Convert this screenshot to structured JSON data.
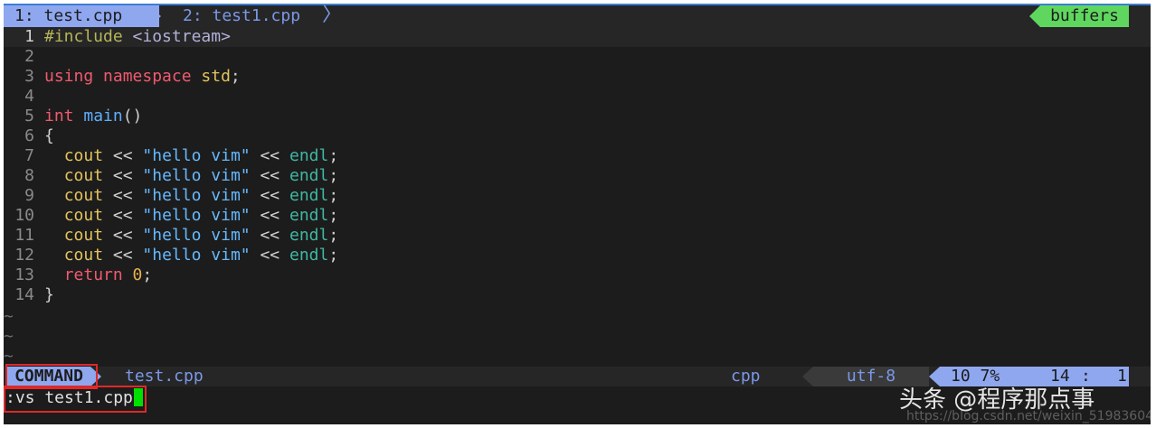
{
  "tabline": {
    "tabs": [
      {
        "label": "1: test.cpp",
        "active": true
      },
      {
        "label": "2: test1.cpp",
        "active": false
      }
    ],
    "separator": "〉",
    "buffers_label": "buffers"
  },
  "editor": {
    "lines": [
      {
        "num": "1",
        "tokens": [
          [
            "c-pre",
            "#include "
          ],
          [
            "c-inc",
            "<iostream>"
          ]
        ]
      },
      {
        "num": "2",
        "tokens": []
      },
      {
        "num": "3",
        "tokens": [
          [
            "c-kw",
            "using namespace "
          ],
          [
            "c-id",
            "std"
          ],
          [
            "c-pl",
            ";"
          ]
        ]
      },
      {
        "num": "4",
        "tokens": []
      },
      {
        "num": "5",
        "tokens": [
          [
            "c-kw",
            "int "
          ],
          [
            "c-fn",
            "main"
          ],
          [
            "c-pl",
            "()"
          ]
        ]
      },
      {
        "num": "6",
        "tokens": [
          [
            "c-pl",
            "{"
          ]
        ]
      },
      {
        "num": "7",
        "tokens": [
          [
            "c-pl",
            "  "
          ],
          [
            "c-id",
            "cout"
          ],
          [
            "c-pl",
            " << "
          ],
          [
            "c-str",
            "\"hello vim\""
          ],
          [
            "c-pl",
            " << "
          ],
          [
            "c-cy",
            "endl"
          ],
          [
            "c-pl",
            ";"
          ]
        ]
      },
      {
        "num": "8",
        "tokens": [
          [
            "c-pl",
            "  "
          ],
          [
            "c-id",
            "cout"
          ],
          [
            "c-pl",
            " << "
          ],
          [
            "c-str",
            "\"hello vim\""
          ],
          [
            "c-pl",
            " << "
          ],
          [
            "c-cy",
            "endl"
          ],
          [
            "c-pl",
            ";"
          ]
        ]
      },
      {
        "num": "9",
        "tokens": [
          [
            "c-pl",
            "  "
          ],
          [
            "c-id",
            "cout"
          ],
          [
            "c-pl",
            " << "
          ],
          [
            "c-str",
            "\"hello vim\""
          ],
          [
            "c-pl",
            " << "
          ],
          [
            "c-cy",
            "endl"
          ],
          [
            "c-pl",
            ";"
          ]
        ]
      },
      {
        "num": "10",
        "tokens": [
          [
            "c-pl",
            "  "
          ],
          [
            "c-id",
            "cout"
          ],
          [
            "c-pl",
            " << "
          ],
          [
            "c-str",
            "\"hello vim\""
          ],
          [
            "c-pl",
            " << "
          ],
          [
            "c-cy",
            "endl"
          ],
          [
            "c-pl",
            ";"
          ]
        ]
      },
      {
        "num": "11",
        "tokens": [
          [
            "c-pl",
            "  "
          ],
          [
            "c-id",
            "cout"
          ],
          [
            "c-pl",
            " << "
          ],
          [
            "c-str",
            "\"hello vim\""
          ],
          [
            "c-pl",
            " << "
          ],
          [
            "c-cy",
            "endl"
          ],
          [
            "c-pl",
            ";"
          ]
        ]
      },
      {
        "num": "12",
        "tokens": [
          [
            "c-pl",
            "  "
          ],
          [
            "c-id",
            "cout"
          ],
          [
            "c-pl",
            " << "
          ],
          [
            "c-str",
            "\"hello vim\""
          ],
          [
            "c-pl",
            " << "
          ],
          [
            "c-cy",
            "endl"
          ],
          [
            "c-pl",
            ";"
          ]
        ]
      },
      {
        "num": "13",
        "tokens": [
          [
            "c-pl",
            "  "
          ],
          [
            "c-kw",
            "return "
          ],
          [
            "c-num",
            "0"
          ],
          [
            "c-pl",
            ";"
          ]
        ]
      },
      {
        "num": "14",
        "tokens": [
          [
            "c-pl",
            "}"
          ]
        ]
      }
    ],
    "current_line": 1,
    "tilde": "~",
    "tilde_count": 3
  },
  "statusline": {
    "mode": "COMMAND",
    "filename": "test.cpp",
    "filetype": "cpp",
    "encoding": "utf-8",
    "percent": "10  7%",
    "line": "14",
    "colon": ":",
    "col": "1"
  },
  "commandline": {
    "text": ":vs test1.cpp"
  },
  "watermark": {
    "text": "头条 @程序那点事",
    "url": "https://blog.csdn.net/weixin_51983604"
  },
  "colors": {
    "background": "#1c1c1c",
    "accent": "#8fa7ee",
    "buffers": "#5fd75f",
    "cursor": "#00e000",
    "highlight_box": "#e02828"
  }
}
